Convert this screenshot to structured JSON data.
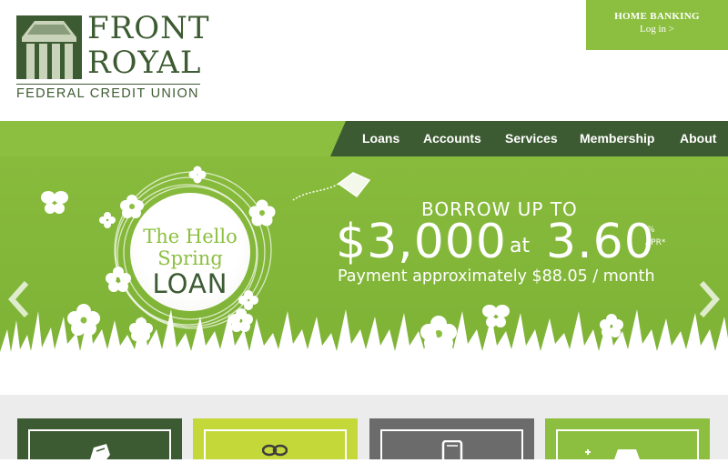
{
  "brand": {
    "name_line1": "FRONT",
    "name_line2": "ROYAL",
    "subtitle": "FEDERAL CREDIT UNION",
    "colors": {
      "dark_green": "#3d5b32",
      "light_green": "#8cbf3f"
    }
  },
  "home_banking": {
    "title": "HOME BANKING",
    "login": "Log in >"
  },
  "nav": {
    "items": [
      {
        "label": "Loans"
      },
      {
        "label": "Accounts"
      },
      {
        "label": "Services"
      },
      {
        "label": "Membership"
      },
      {
        "label": "About"
      }
    ]
  },
  "hero": {
    "badge": {
      "line1": "The Hello",
      "line2": "Spring",
      "line3": "LOAN"
    },
    "headline": "BORROW UP TO",
    "amount": "$3,000",
    "at": "at",
    "rate": "3.60",
    "rate_percent": "%",
    "rate_label": "APR*",
    "payment": "Payment approximately $88.05 / month",
    "prev_icon": "chevron-left-icon",
    "next_icon": "chevron-right-icon"
  },
  "tiles": [
    {
      "icon": "ticket-icon",
      "color": "#3d5b32"
    },
    {
      "icon": "gift-icon",
      "color": "#c5d83a"
    },
    {
      "icon": "mobile-phone-icon",
      "color": "#6b6b6b"
    },
    {
      "icon": "car-icon",
      "color": "#8cbf3f"
    }
  ]
}
